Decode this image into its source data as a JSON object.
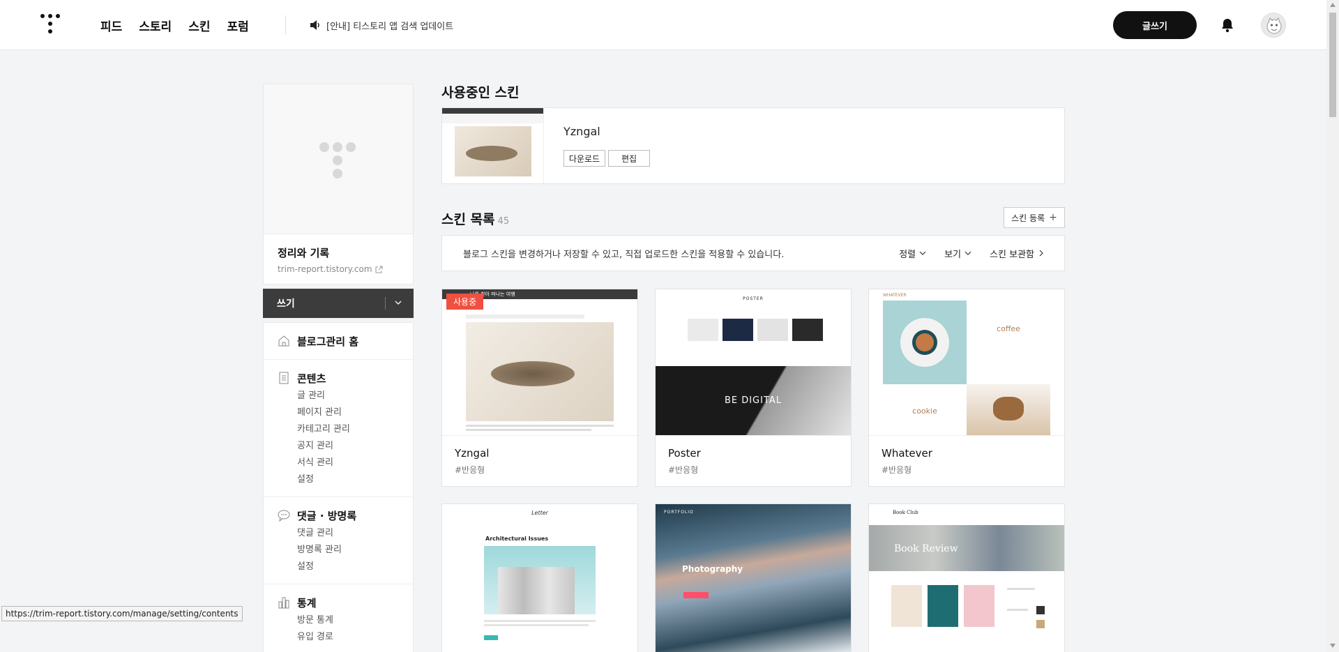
{
  "header": {
    "nav": [
      "피드",
      "스토리",
      "스킨",
      "포럼"
    ],
    "notice": "[안내] 티스토리 앱 검색 업데이트",
    "write_label": "글쓰기"
  },
  "sidebar": {
    "blog_name": "정리와 기록",
    "blog_url": "trim-report.tistory.com",
    "write_label": "쓰기",
    "groups": [
      {
        "title": "블로그관리 홈",
        "icon": "home-icon",
        "items": []
      },
      {
        "title": "콘텐츠",
        "icon": "document-icon",
        "items": [
          "글 관리",
          "페이지 관리",
          "카테고리 관리",
          "공지 관리",
          "서식 관리",
          "설정"
        ]
      },
      {
        "title": "댓글 · 방명록",
        "icon": "speech-bubble-icon",
        "items": [
          "댓글 관리",
          "방명록 관리",
          "설정"
        ]
      },
      {
        "title": "통계",
        "icon": "bar-chart-icon",
        "items": [
          "방문 통계",
          "유입 경로"
        ]
      }
    ]
  },
  "current_skin": {
    "section_title": "사용중인 스킨",
    "name": "Yzngal",
    "download_label": "다운로드",
    "edit_label": "편집"
  },
  "skin_list": {
    "section_title": "스킨 목록",
    "count": "45",
    "register_label": "스킨 등록",
    "description": "블로그 스킨을 변경하거나 저장할 수 있고, 직접 업로드한 스킨을 적용할 수 있습니다.",
    "sort_label": "정렬",
    "view_label": "보기",
    "storage_label": "스킨 보관함",
    "using_badge": "사용중",
    "skins": [
      {
        "name": "Yzngal",
        "tag": "#반응형"
      },
      {
        "name": "Poster",
        "tag": "#반응형"
      },
      {
        "name": "Whatever",
        "tag": "#반응형"
      }
    ],
    "previews": {
      "yzngal_header": "나를 찾아 떠나는 여행",
      "poster_logo": "POSTER",
      "poster_banner": "BE DIGITAL",
      "whatever_logo": "WHATEVER",
      "whatever_coffee": "coffee",
      "whatever_cookie": "cookie",
      "letter_logo": "Letter",
      "letter_title": "Architectural Issues",
      "portfolio_logo": "PORTFOLIO",
      "portfolio_title": "Photography",
      "bookclub_logo": "Book Club",
      "bookclub_title": "Book Review"
    }
  },
  "status_url": "https://trim-report.tistory.com/manage/setting/contents"
}
